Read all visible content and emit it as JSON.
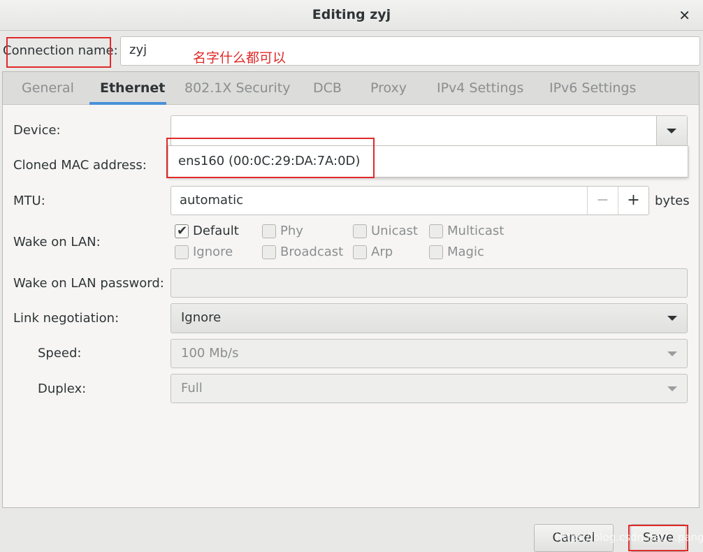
{
  "window": {
    "title": "Editing zyj",
    "close_icon": "close-icon"
  },
  "connection": {
    "label": "Connection name:",
    "value": "zyj",
    "annotation": "名字什么都可以"
  },
  "tabs": [
    {
      "label": "General"
    },
    {
      "label": "Ethernet",
      "active": true
    },
    {
      "label": "802.1X Security"
    },
    {
      "label": "DCB"
    },
    {
      "label": "Proxy"
    },
    {
      "label": "IPv4 Settings"
    },
    {
      "label": "IPv6 Settings"
    }
  ],
  "ethernet": {
    "device_label": "Device:",
    "device_value": "",
    "device_option": "ens160 (00:0C:29:DA:7A:0D)",
    "cloned_mac_label": "Cloned MAC address:",
    "mtu_label": "MTU:",
    "mtu_value": "automatic",
    "mtu_minus": "−",
    "mtu_plus": "+",
    "mtu_unit": "bytes",
    "wol_label": "Wake on LAN:",
    "wol_options": [
      {
        "label": "Default",
        "checked": true
      },
      {
        "label": "Phy",
        "checked": false
      },
      {
        "label": "Unicast",
        "checked": false
      },
      {
        "label": "Multicast",
        "checked": false
      },
      {
        "label": "Ignore",
        "checked": false
      },
      {
        "label": "Broadcast",
        "checked": false
      },
      {
        "label": "Arp",
        "checked": false
      },
      {
        "label": "Magic",
        "checked": false
      }
    ],
    "wol_password_label": "Wake on LAN password:",
    "wol_password_value": "",
    "link_negotiation_label": "Link negotiation:",
    "link_negotiation_value": "Ignore",
    "speed_label": "Speed:",
    "speed_value": "100 Mb/s",
    "duplex_label": "Duplex:",
    "duplex_value": "Full"
  },
  "footer": {
    "cancel": "Cancel",
    "save": "Save",
    "watermark": "https://blog.csdn.net/...pang"
  },
  "colors": {
    "accent": "#4a90d9",
    "annotation_red": "#e02a2a"
  }
}
